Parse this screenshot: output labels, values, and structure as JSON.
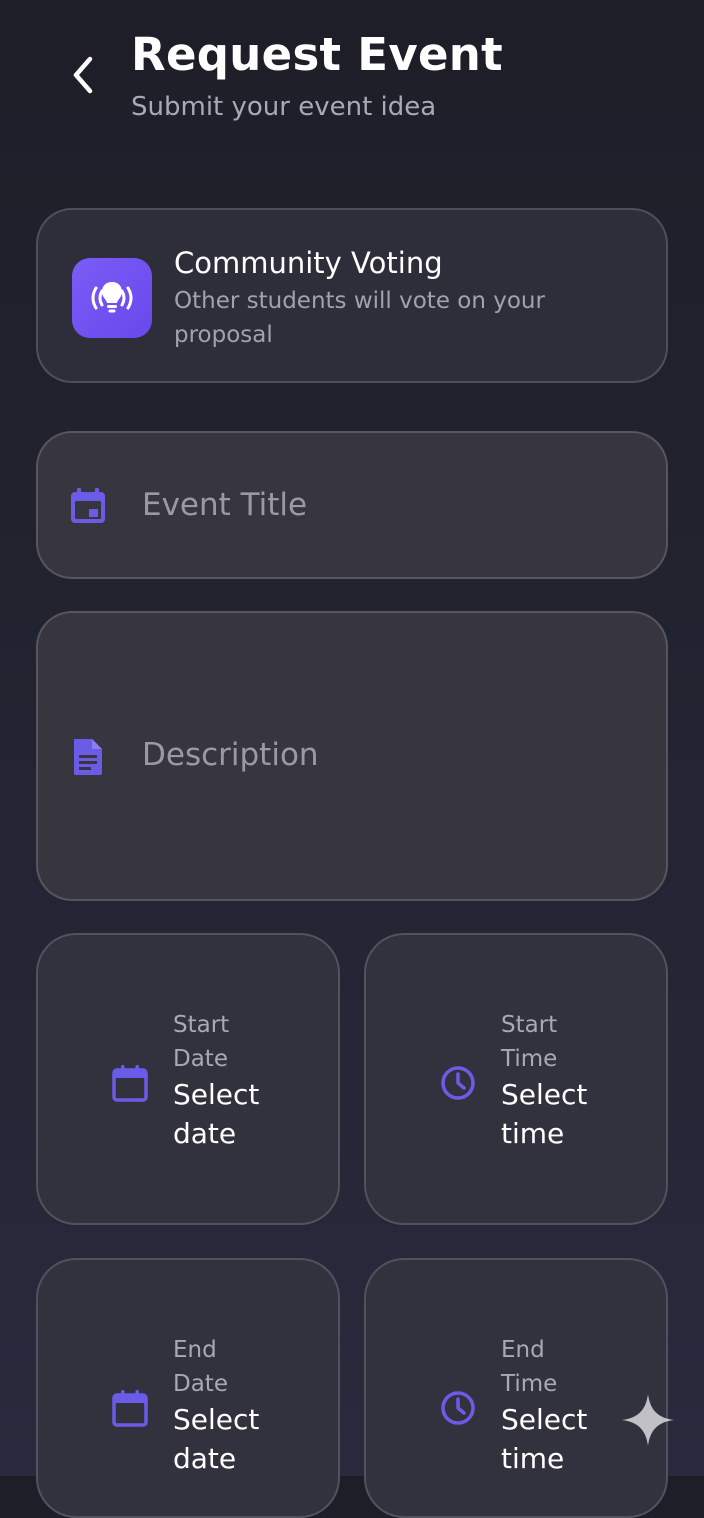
{
  "header": {
    "title": "Request Event",
    "subtitle": "Submit your event idea"
  },
  "voting_card": {
    "title": "Community Voting",
    "description": "Other students will vote on your proposal",
    "icon": "lightbulb-broadcast-icon"
  },
  "form": {
    "event_title_placeholder": "Event Title",
    "description_placeholder": "Description",
    "start_date": {
      "label": "Start Date",
      "value": "Select date",
      "icon": "calendar-icon"
    },
    "start_time": {
      "label": "Start Time",
      "value": "Select time",
      "icon": "clock-icon"
    },
    "end_date": {
      "label": "End Date",
      "value": "Select date",
      "icon": "calendar-icon"
    },
    "end_time": {
      "label": "End Time",
      "value": "Select time",
      "icon": "clock-icon"
    }
  },
  "colors": {
    "accent": "#6b5ce7",
    "brand_gradient_start": "#7a5cf6",
    "brand_gradient_end": "#6a48ec"
  }
}
